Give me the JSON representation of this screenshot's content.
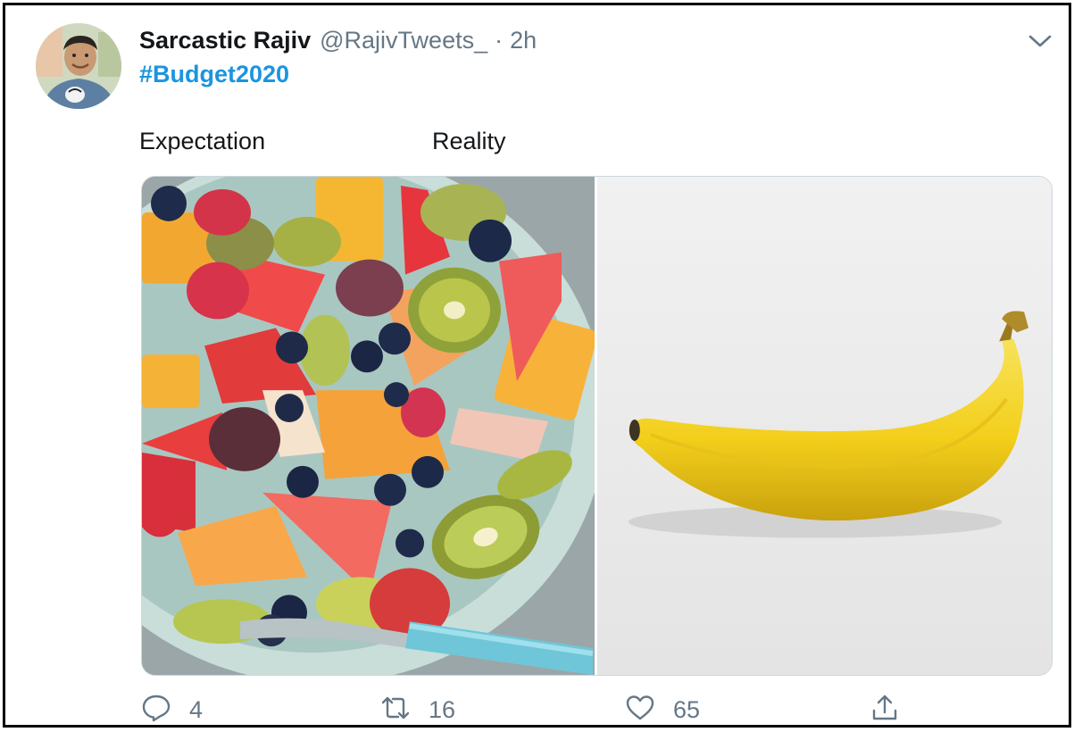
{
  "tweet": {
    "display_name": "Sarcastic Rajiv",
    "handle": "@RajivTweets_",
    "separator": "·",
    "time": "2h",
    "hashtag": "#Budget2020",
    "captions": {
      "left": "Expectation",
      "right": "Reality"
    },
    "media": {
      "left_image": "fruit-salad-bowl",
      "right_image": "single-banana"
    }
  },
  "actions": {
    "reply": {
      "icon": "reply-icon",
      "count": "4"
    },
    "retweet": {
      "icon": "retweet-icon",
      "count": "16"
    },
    "like": {
      "icon": "heart-icon",
      "count": "65"
    },
    "share": {
      "icon": "share-icon"
    }
  },
  "colors": {
    "hashtag": "#1b95e0",
    "secondary_text": "#657786",
    "primary_text": "#14171a"
  }
}
